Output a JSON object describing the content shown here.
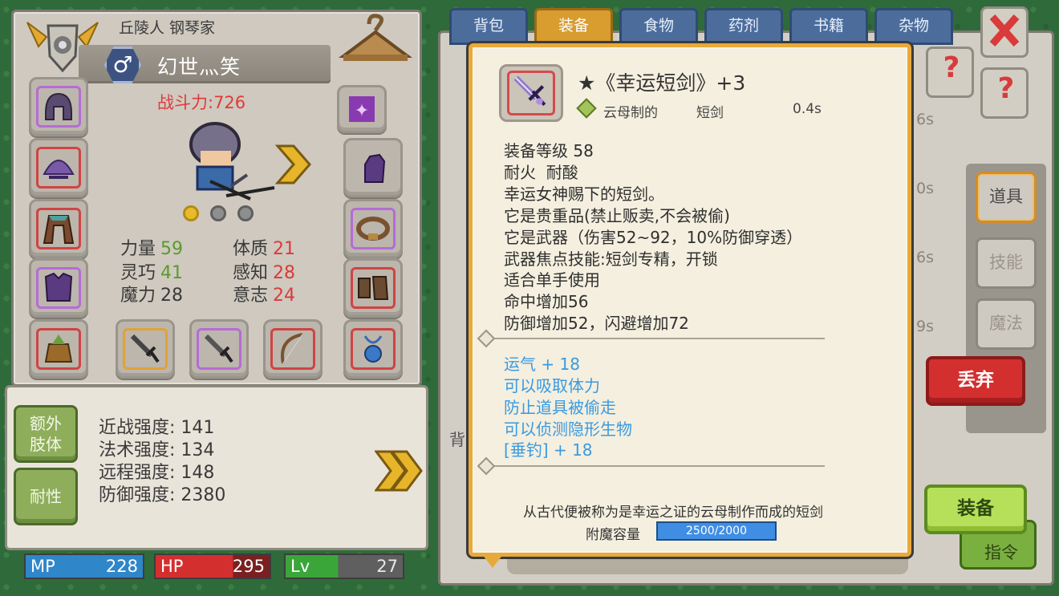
{
  "character": {
    "title": "丘陵人 钢琴家",
    "gender_symbol": "♂",
    "name": "幻世灬笑",
    "power": "战斗力:726",
    "stats": [
      {
        "label": "力量",
        "value": "59",
        "color": "green"
      },
      {
        "label": "体质",
        "value": "21",
        "color": "red"
      },
      {
        "label": "灵巧",
        "value": "41",
        "color": "green"
      },
      {
        "label": "感知",
        "value": "28",
        "color": "red"
      },
      {
        "label": "魔力",
        "value": "28",
        "color": "neutral"
      },
      {
        "label": "意志",
        "value": "24",
        "color": "red"
      }
    ]
  },
  "strength_panel": {
    "buttons": [
      "额外\n肢体",
      "耐性"
    ],
    "lines": [
      "近战强度: 141",
      "法术强度: 134",
      "远程强度: 148",
      "防御强度: 2380"
    ]
  },
  "bars": {
    "mp": {
      "label": "MP",
      "value": "228",
      "color": "#2f86c9"
    },
    "hp": {
      "label": "HP",
      "value": "295",
      "color": "#d42f2f"
    },
    "lv": {
      "label": "Lv",
      "value": "27",
      "color": "#3aa63a"
    }
  },
  "inventory": {
    "tabs": [
      "背包",
      "装备",
      "食物",
      "药剂",
      "书籍",
      "杂物"
    ],
    "active_tab": "装备",
    "side_tabs": [
      "道具",
      "技能",
      "魔法"
    ],
    "times": [
      "6s",
      "0s",
      "6s",
      "9s"
    ],
    "partial_label": "背"
  },
  "tooltip": {
    "title": "★《幸运短剑》+3",
    "material": "云母制的",
    "type": "短剑",
    "speed": "0.4s",
    "desc": [
      "装备等级 58",
      "耐火  耐酸",
      "幸运女神赐下的短剑。",
      "它是贵重品(禁止贩卖,不会被偷)",
      "它是武器（伤害52~92，10%防御穿透）",
      "武器焦点技能:短剑专精，开锁",
      "适合单手使用",
      "命中增加56",
      "防御增加52，闪避增加72"
    ],
    "enchants": [
      "运气 + 18",
      "可以吸取体力",
      "防止道具被偷走",
      "可以侦测隐形生物",
      "[垂钓] + 18"
    ],
    "lore": "从古代便被称为是幸运之证的云母制作而成的短剑",
    "enchant_label": "附魔容量",
    "enchant_value": "2500/2000"
  },
  "buttons": {
    "drop": "丢弃",
    "equip": "装备",
    "under_partial": "指令",
    "help": "?"
  },
  "icons": [
    "emblem-icon",
    "hanger-icon",
    "helmet-icon",
    "shell-icon",
    "cloak-icon",
    "armor-icon",
    "pouch-icon",
    "rune-icon",
    "gauntlet-icon",
    "belt-icon",
    "boots-icon",
    "amulet-icon",
    "dagger-icon",
    "bow-icon",
    "close-icon",
    "question-icon"
  ]
}
